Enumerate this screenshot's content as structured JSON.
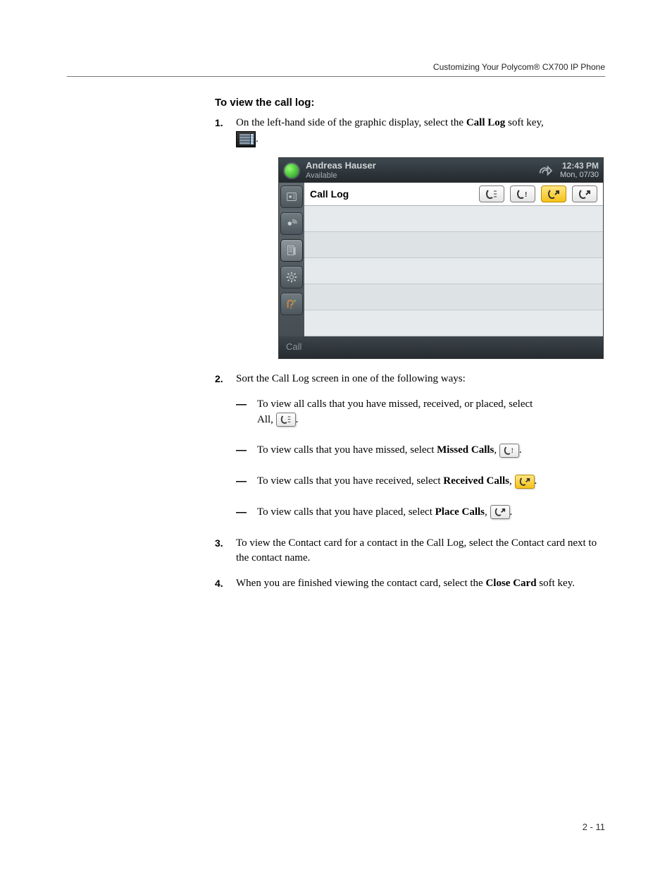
{
  "runningHeader": "Customizing Your Polycom® CX700 IP Phone",
  "heading": "To view the call log:",
  "step1": {
    "num": "1.",
    "pre": "On the left-hand side of the graphic display, select the ",
    "bold": "Call Log",
    "post": " soft key, "
  },
  "screenshot": {
    "userName": "Andreas Hauser",
    "presence": "Available",
    "time": "12:43 PM",
    "date": "Mon, 07/30",
    "mainTitle": "Call Log",
    "footerLabel": "Call"
  },
  "step2": {
    "num": "2.",
    "text": "Sort the Call Log screen in one of the following ways:",
    "sub1_a": "To view all calls that you have missed, received, or placed, select ",
    "sub1_b": "All,",
    "sub2_a": "To view calls that you have missed, select ",
    "sub2_b": "Missed Calls",
    "sub2_c": ", ",
    "sub3_a": "To view calls that you have received, select ",
    "sub3_b": "Received Calls",
    "sub3_c": ", ",
    "sub4_a": "To view calls that you have placed, select ",
    "sub4_b": "Place Calls",
    "sub4_c": ", "
  },
  "step3": {
    "num": "3.",
    "text": "To view the Contact card for a contact in the Call Log, select the Contact card next to the contact name."
  },
  "step4": {
    "num": "4.",
    "pre": "When you are finished viewing the contact card, select the ",
    "bold": "Close Card",
    "post": " soft key."
  },
  "pageNumber": "2 - 11"
}
